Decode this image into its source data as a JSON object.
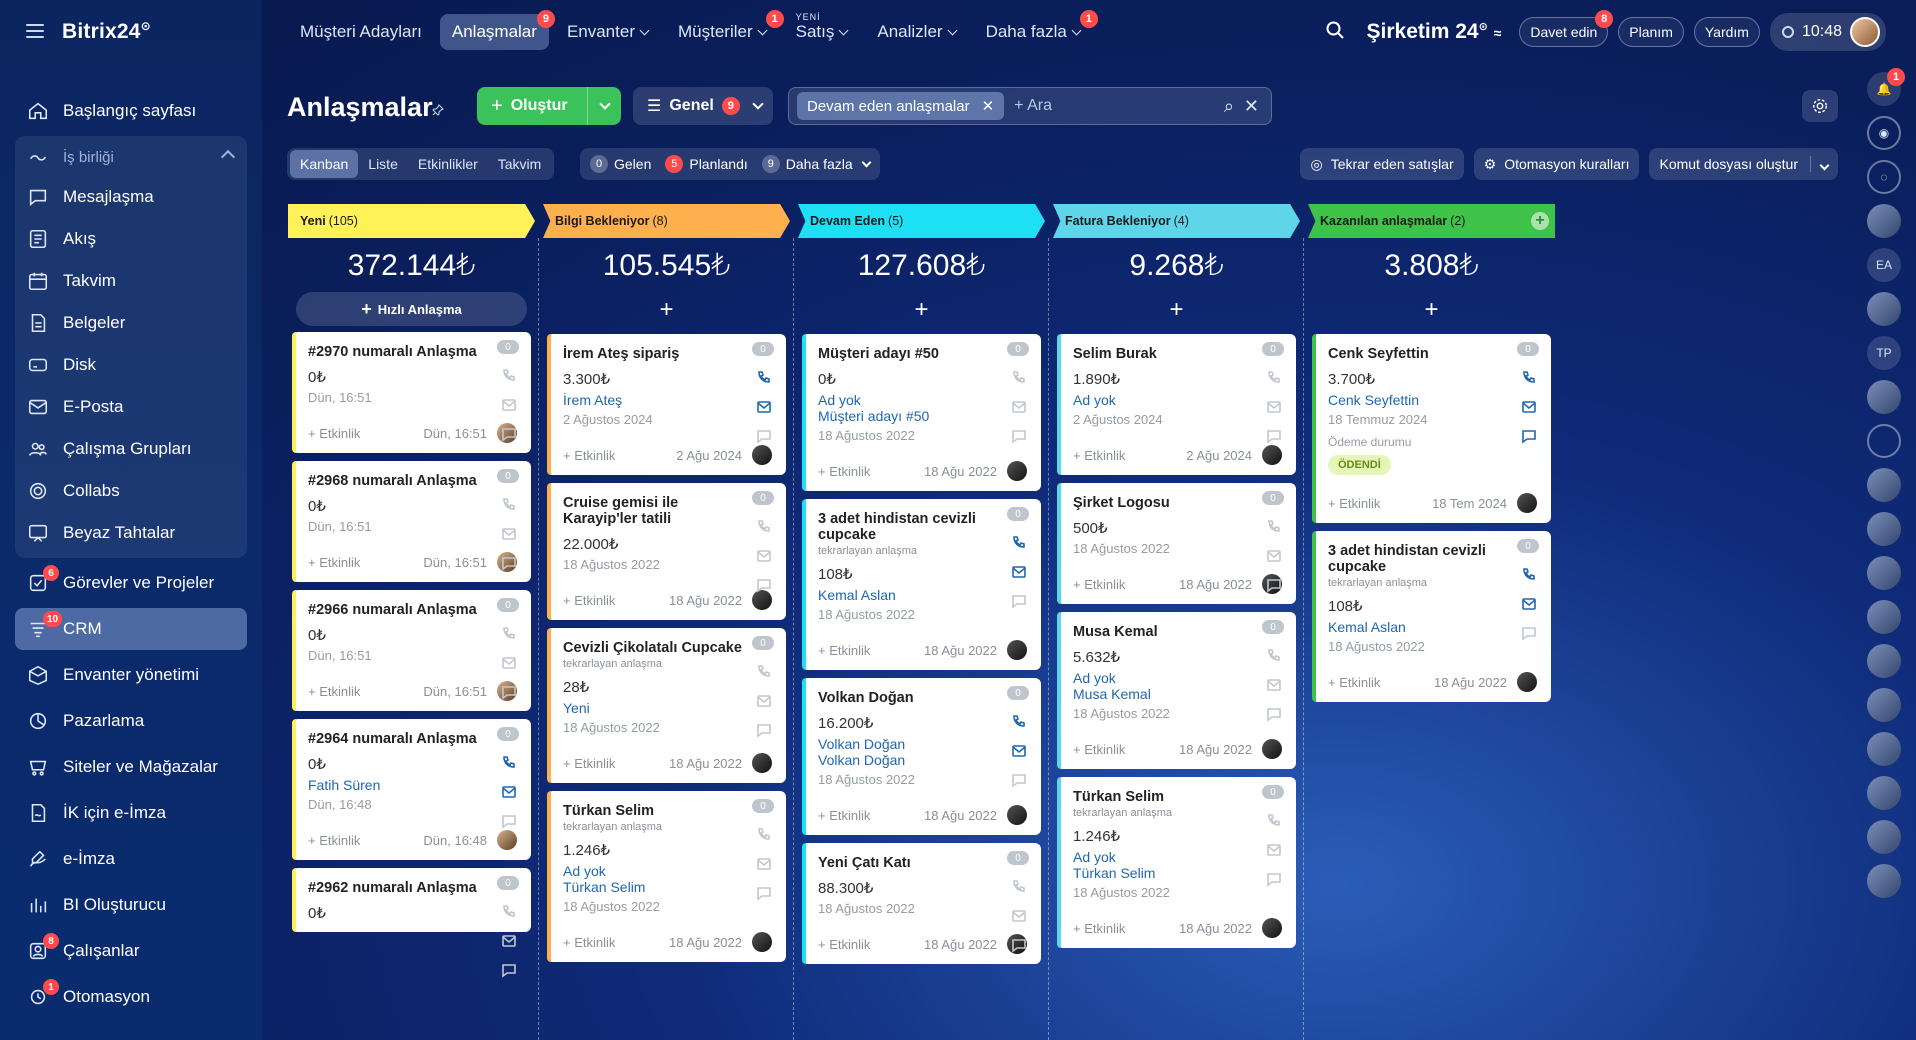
{
  "app": {
    "logo": "Bitrix24",
    "logo_mark": "⊙"
  },
  "sidebar": {
    "items": [
      {
        "label": "Başlangıç sayfası",
        "icon": "home-icon"
      },
      {
        "label": "Mesajlaşma",
        "icon": "chat-icon"
      },
      {
        "label": "Akış",
        "icon": "feed-icon"
      },
      {
        "label": "Takvim",
        "icon": "calendar-icon"
      },
      {
        "label": "Belgeler",
        "icon": "document-icon"
      },
      {
        "label": "Disk",
        "icon": "disk-icon"
      },
      {
        "label": "E-Posta",
        "icon": "mail-icon"
      },
      {
        "label": "Çalışma Grupları",
        "icon": "group-icon"
      },
      {
        "label": "Collabs",
        "icon": "collab-icon"
      },
      {
        "label": "Beyaz Tahtalar",
        "icon": "whiteboard-icon"
      },
      {
        "label": "Görevler ve Projeler",
        "icon": "tasks-icon",
        "badge": "6"
      },
      {
        "label": "CRM",
        "icon": "crm-icon",
        "badge": "10"
      },
      {
        "label": "Envanter yönetimi",
        "icon": "inventory-icon"
      },
      {
        "label": "Pazarlama",
        "icon": "marketing-icon"
      },
      {
        "label": "Siteler ve Mağazalar",
        "icon": "store-icon"
      },
      {
        "label": "İK için e-İmza",
        "icon": "hr-sign-icon"
      },
      {
        "label": "e-İmza",
        "icon": "sign-icon"
      },
      {
        "label": "BI Oluşturucu",
        "icon": "bi-icon"
      },
      {
        "label": "Çalışanlar",
        "icon": "employees-icon",
        "badge": "8"
      },
      {
        "label": "Otomasyon",
        "icon": "automation-icon",
        "badge": "1"
      }
    ],
    "group_label": "İş birliği"
  },
  "topnav": {
    "items": [
      {
        "label": "Müşteri Adayları"
      },
      {
        "label": "Anlaşmalar",
        "badge": "9"
      },
      {
        "label": "Envanter"
      },
      {
        "label": "Müşteriler",
        "badge": "1"
      },
      {
        "label": "Satış",
        "new_tag": "YENİ"
      },
      {
        "label": "Analizler"
      },
      {
        "label": "Daha fazla",
        "badge": "1"
      }
    ],
    "company": "Şirketim 24",
    "invite": "Davet edin",
    "invite_badge": "8",
    "plan": "Planım",
    "help": "Yardım",
    "time": "10:48"
  },
  "header": {
    "title": "Anlaşmalar",
    "create": "Oluştur",
    "filter": "Genel",
    "filter_badge": "9",
    "chip": "Devam eden anlaşmalar",
    "search_placeholder": "+ Ara"
  },
  "views": [
    "Kanban",
    "Liste",
    "Etkinlikler",
    "Takvim"
  ],
  "counters": {
    "incoming": {
      "num": "0",
      "label": "Gelen"
    },
    "planned": {
      "num": "5",
      "label": "Planlandı"
    },
    "more": {
      "num": "9",
      "label": "Daha fazla"
    }
  },
  "tools": {
    "recurring": "Tekrar eden satışlar",
    "automation": "Otomasyon kuralları",
    "script": "Komut dosyası oluştur"
  },
  "quick_deal": "Hızlı Anlaşma",
  "activity_label": "+ Etkinlik",
  "colors": {
    "yeni": "#fff259",
    "bilgi": "#ffb04e",
    "devam": "#1ee0f5",
    "fatura": "#5fd5ea",
    "kazanilan": "#3ec247",
    "link": "#2067b0"
  },
  "columns": [
    {
      "name": "Yeni",
      "count": "(105)",
      "total": "372.144₺",
      "cards": [
        {
          "title": "#2970 numaralı Anlaşma",
          "amount": "0₺",
          "date": "Dün, 16:51",
          "foot": "Dün, 16:51"
        },
        {
          "title": "#2968 numaralı Anlaşma",
          "amount": "0₺",
          "date": "Dün, 16:51",
          "foot": "Dün, 16:51"
        },
        {
          "title": "#2966 numaralı Anlaşma",
          "amount": "0₺",
          "date": "Dün, 16:51",
          "foot": "Dün, 16:51"
        },
        {
          "title": "#2964 numaralı Anlaşma",
          "amount": "0₺",
          "link1": "Fatih Süren",
          "date": "Dün, 16:48",
          "foot": "Dün, 16:48"
        },
        {
          "title": "#2962 numaralı Anlaşma",
          "amount": "0₺"
        }
      ]
    },
    {
      "name": "Bilgi Bekleniyor",
      "count": "(8)",
      "total": "105.545₺",
      "cards": [
        {
          "title": "İrem Ateş sipariş",
          "amount": "3.300₺",
          "link1": "İrem Ateş",
          "date": "2 Ağustos 2024",
          "foot": "2 Ağu 2024"
        },
        {
          "title": "Cruise gemisi ile Karayip'ler tatili",
          "amount": "22.000₺",
          "date": "18 Ağustos 2022",
          "foot": "18 Ağu 2022"
        },
        {
          "title": "Cevizli Çikolatalı Cupcake",
          "sub": "tekrarlayan anlaşma",
          "amount": "28₺",
          "link1": "Yeni",
          "date": "18 Ağustos 2022",
          "foot": "18 Ağu 2022"
        },
        {
          "title": "Türkan Selim",
          "sub": "tekrarlayan anlaşma",
          "amount": "1.246₺",
          "link1": "Ad yok",
          "link2": "Türkan Selim",
          "date": "18 Ağustos 2022",
          "foot": "18 Ağu 2022"
        }
      ]
    },
    {
      "name": "Devam Eden",
      "count": "(5)",
      "total": "127.608₺",
      "cards": [
        {
          "title": "Müşteri adayı #50",
          "amount": "0₺",
          "link1": "Ad yok",
          "link2": "Müşteri adayı #50",
          "date": "18 Ağustos 2022",
          "foot": "18 Ağu 2022"
        },
        {
          "title": "3 adet hindistan cevizli cupcake",
          "sub": "tekrarlayan anlaşma",
          "amount": "108₺",
          "link1": "Kemal Aslan",
          "date": "18 Ağustos 2022",
          "foot": "18 Ağu 2022"
        },
        {
          "title": "Volkan Doğan",
          "amount": "16.200₺",
          "link1": "Volkan Doğan",
          "link2": "Volkan Doğan",
          "date": "18 Ağustos 2022",
          "foot": "18 Ağu 2022"
        },
        {
          "title": "Yeni Çatı Katı",
          "amount": "88.300₺",
          "date": "18 Ağustos 2022",
          "foot": "18 Ağu 2022"
        }
      ]
    },
    {
      "name": "Fatura Bekleniyor",
      "count": "(4)",
      "total": "9.268₺",
      "cards": [
        {
          "title": "Selim Burak",
          "amount": "1.890₺",
          "link1": "Ad yok",
          "date": "2 Ağustos 2024",
          "foot": "2 Ağu 2024"
        },
        {
          "title": "Şirket Logosu",
          "amount": "500₺",
          "date": "18 Ağustos 2022",
          "foot": "18 Ağu 2022"
        },
        {
          "title": "Musa Kemal",
          "amount": "5.632₺",
          "link1": "Ad yok",
          "link2": "Musa Kemal",
          "date": "18 Ağustos 2022",
          "foot": "18 Ağu 2022"
        },
        {
          "title": "Türkan Selim",
          "sub": "tekrarlayan anlaşma",
          "amount": "1.246₺",
          "link1": "Ad yok",
          "link2": "Türkan Selim",
          "date": "18 Ağustos 2022",
          "foot": "18 Ağu 2022"
        }
      ]
    },
    {
      "name": "Kazanılan anlaşmalar",
      "count": "(2)",
      "total": "3.808₺",
      "cards": [
        {
          "title": "Cenk Seyfettin",
          "amount": "3.700₺",
          "link1": "Cenk Seyfettin",
          "date": "18 Temmuz 2024",
          "paylbl": "Ödeme durumu",
          "paid": "ÖDENDİ",
          "foot": "18 Tem 2024"
        },
        {
          "title": "3 adet hindistan cevizli cupcake",
          "sub": "tekrarlayan anlaşma",
          "amount": "108₺",
          "link1": "Kemal Aslan",
          "date": "18 Ağustos 2022",
          "foot": "18 Ağu 2022"
        }
      ]
    }
  ],
  "rail": [
    "EA",
    "TP"
  ]
}
